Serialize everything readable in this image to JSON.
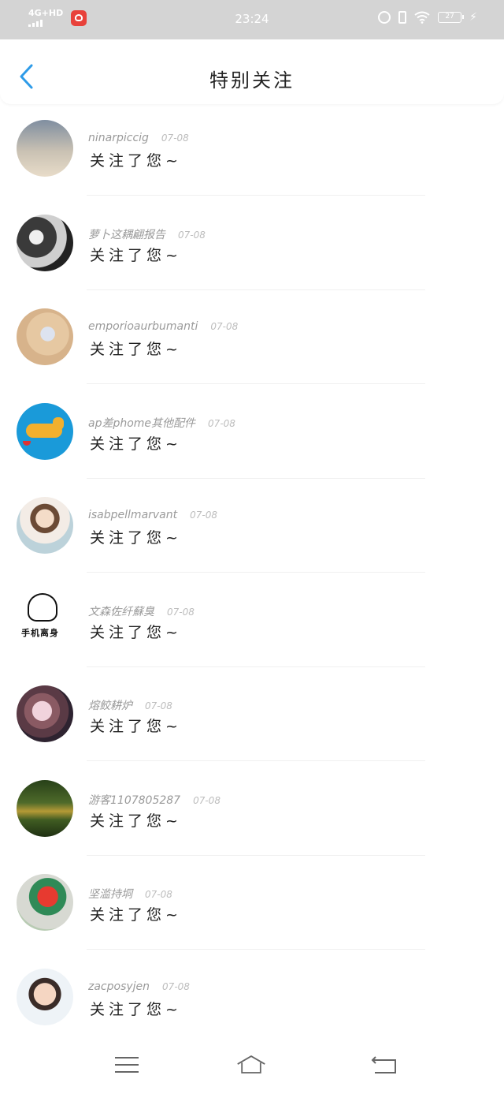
{
  "status_bar": {
    "network": "4G+HD",
    "time": "23:24",
    "battery": "27",
    "icons": [
      "signal-icon",
      "app-icon",
      "alarm-icon",
      "vibrate-icon",
      "wifi-icon",
      "battery-icon",
      "charging-icon"
    ]
  },
  "header": {
    "title": "特别关注",
    "back_icon": "chevron-left-icon"
  },
  "list": {
    "items": [
      {
        "name": "ninarpiccig",
        "date": "07-08",
        "action": "关注了您~"
      },
      {
        "name": "萝卜这耦翩报告",
        "date": "07-08",
        "action": "关注了您~"
      },
      {
        "name": "emporioaurbumanti",
        "date": "07-08",
        "action": "关注了您~"
      },
      {
        "name": "ap差phome其他配件",
        "date": "07-08",
        "action": "关注了您~"
      },
      {
        "name": "isabpellmarvant",
        "date": "07-08",
        "action": "关注了您~"
      },
      {
        "name": "文森佐纤蘇臭",
        "date": "07-08",
        "action": "关注了您~"
      },
      {
        "name": "熔鲛耕炉",
        "date": "07-08",
        "action": "关注了您~"
      },
      {
        "name": "游客1107805287",
        "date": "07-08",
        "action": "关注了您~"
      },
      {
        "name": "坚滥持垌",
        "date": "07-08",
        "action": "关注了您~"
      },
      {
        "name": "zacposyjen",
        "date": "07-08",
        "action": "关注了您~"
      }
    ],
    "avatar6_caption": "手机离身"
  },
  "nav_bar": {
    "icons": [
      "menu-icon",
      "home-icon",
      "back-icon"
    ]
  },
  "colors": {
    "status_bar_bg": "#d4d4d4",
    "accent": "#2e9be8",
    "name_text": "#9a9a9a",
    "date_text": "#bdbdbd"
  }
}
